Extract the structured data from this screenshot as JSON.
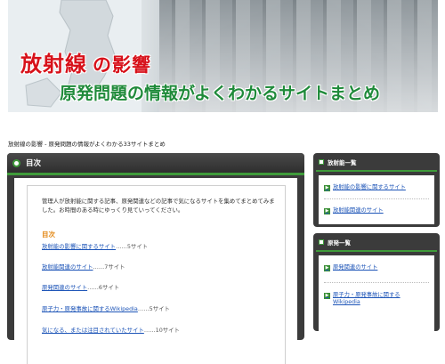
{
  "banner": {
    "title_main": "放射線",
    "title_sub": "の影響",
    "tagline": "原発問題の情報がよくわかるサイトまとめ"
  },
  "breadcrumb": "放射線の影響 - 原発問題の情報がよくわかる33サイトまとめ",
  "main": {
    "heading": "目次",
    "intro": "管理人が放射能に関する記事、原発関連などの記事で気になるサイトを集めてまとめてみました。お時間のある時にゆっくり見ていってください。",
    "toc_title": "目次",
    "toc": [
      {
        "label": "放射能の影響に関するサイト",
        "count": "……5サイト"
      },
      {
        "label": "放射能関連のサイト",
        "count": "……7サイト"
      },
      {
        "label": "原発関連のサイト",
        "count": "……6サイト"
      },
      {
        "label": "原子力・原発事故に関するWikipedia",
        "count": "……5サイト"
      },
      {
        "label": "気になる、または注目されていたサイト",
        "count": "……10サイト"
      }
    ]
  },
  "sidebar": [
    {
      "heading": "放射能一覧",
      "items": [
        {
          "label": "放射能の影響に関するサイト"
        },
        {
          "label": "放射能関連のサイト"
        }
      ]
    },
    {
      "heading": "原発一覧",
      "items": [
        {
          "label": "原発関連のサイト"
        },
        {
          "label": "原子力・原発事故に関するWikipedia"
        }
      ]
    }
  ],
  "colors": {
    "title_red": "#d7111a",
    "tagline_green": "#1f8a3a",
    "panel_dark": "#3b3b3b",
    "accent_green": "#3f9b3a",
    "link_blue": "#1f56b8",
    "toc_orange": "#e38a1a"
  }
}
